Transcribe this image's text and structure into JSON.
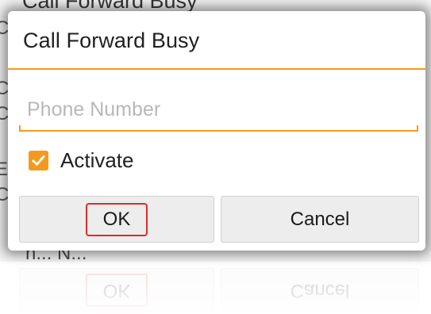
{
  "background": {
    "title": "Call Forward Busy",
    "left_chars": [
      "C",
      "C",
      "C",
      "E",
      "C"
    ],
    "bottom_text": "n... N..."
  },
  "dialog": {
    "title": "Call Forward Busy",
    "phone_input": {
      "value": "",
      "placeholder": "Phone Number"
    },
    "activate": {
      "label": "Activate",
      "checked": true
    },
    "buttons": {
      "ok_label": "OK",
      "cancel_label": "Cancel"
    }
  },
  "colors": {
    "accent": "#f39a1e",
    "highlight": "#e02a2a",
    "button_bg": "#ededed"
  },
  "icons": {
    "checkbox": "check-icon"
  }
}
